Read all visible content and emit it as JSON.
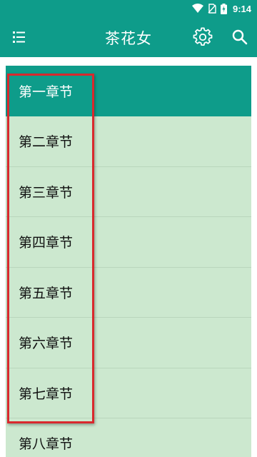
{
  "status_bar": {
    "time": "9:14",
    "icons": [
      "wifi-icon",
      "no-sim-icon",
      "battery-charging-icon"
    ]
  },
  "toolbar": {
    "title": "茶花女",
    "icons": [
      "menu-icon",
      "gear-icon",
      "search-icon"
    ],
    "color": "#0e9c8a"
  },
  "chapters": [
    {
      "label": "第一章节",
      "selected": true
    },
    {
      "label": "第二章节",
      "selected": false
    },
    {
      "label": "第三章节",
      "selected": false
    },
    {
      "label": "第四章节",
      "selected": false
    },
    {
      "label": "第五章节",
      "selected": false
    },
    {
      "label": "第六章节",
      "selected": false
    },
    {
      "label": "第七章节",
      "selected": false
    },
    {
      "label": "第八章节",
      "selected": false
    }
  ],
  "colors": {
    "list_background": "#cce8cf",
    "selected_background": "#0e9c8a",
    "highlight_box": "#d9282d"
  }
}
